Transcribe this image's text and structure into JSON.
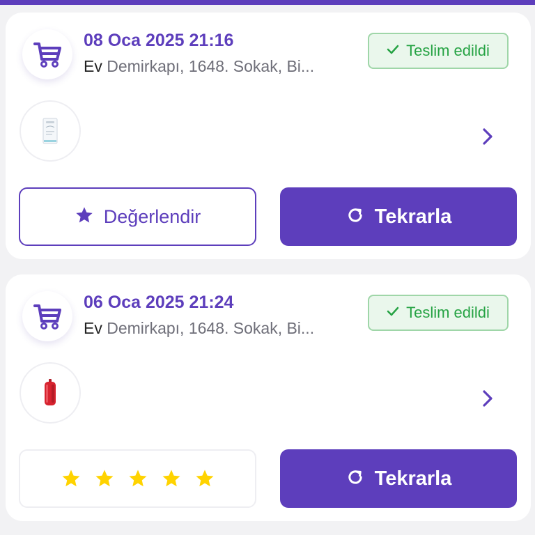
{
  "colors": {
    "brand": "#5d3ebc",
    "delivered_green": "#26a344",
    "star_yellow": "#ffd300"
  },
  "orders": [
    {
      "date": "08 Oca 2025 21:16",
      "address_label": "Ev",
      "address": "Demirkapı, 1648. Sokak, Bi...",
      "status": "Teslim edildi",
      "status_icon": "check-icon",
      "product_icon": "product-box-thumbnail",
      "rate_label": "Değerlendir",
      "repeat_label": "Tekrarla"
    },
    {
      "date": "06 Oca 2025 21:24",
      "address_label": "Ev",
      "address": "Demirkapı, 1648. Sokak, Bi...",
      "status": "Teslim edildi",
      "status_icon": "check-icon",
      "product_icon": "red-speaker-thumbnail",
      "rating": 5,
      "rating_max": 5,
      "repeat_label": "Tekrarla"
    }
  ]
}
